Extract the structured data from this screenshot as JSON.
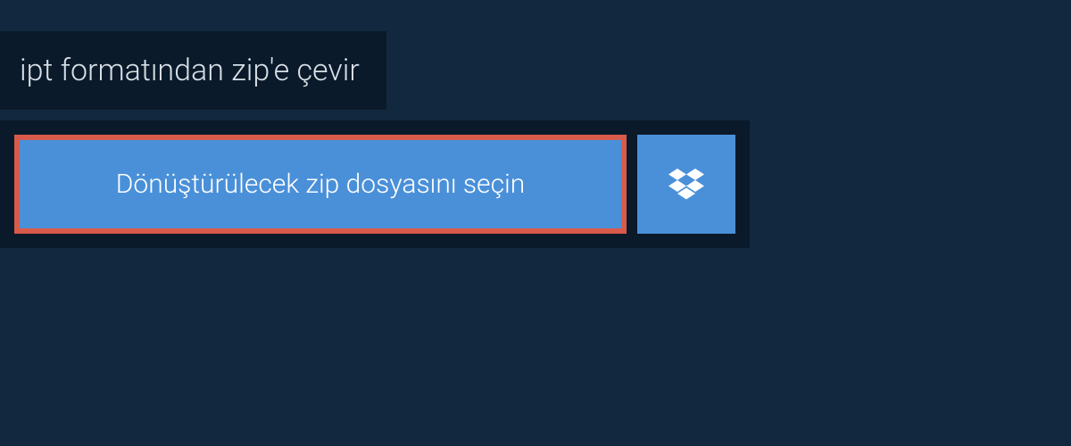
{
  "header": {
    "title": "ipt formatından zip'e çevir"
  },
  "upload": {
    "select_file_label": "Dönüştürülecek zip dosyasını seçin",
    "dropbox_icon_name": "dropbox-icon"
  },
  "colors": {
    "page_bg": "#12283f",
    "panel_bg": "#0a1a2a",
    "button_bg": "#4a90d9",
    "button_border_highlight": "#d85a4a",
    "text_light": "#d8dfe6",
    "text_white": "#ffffff"
  }
}
